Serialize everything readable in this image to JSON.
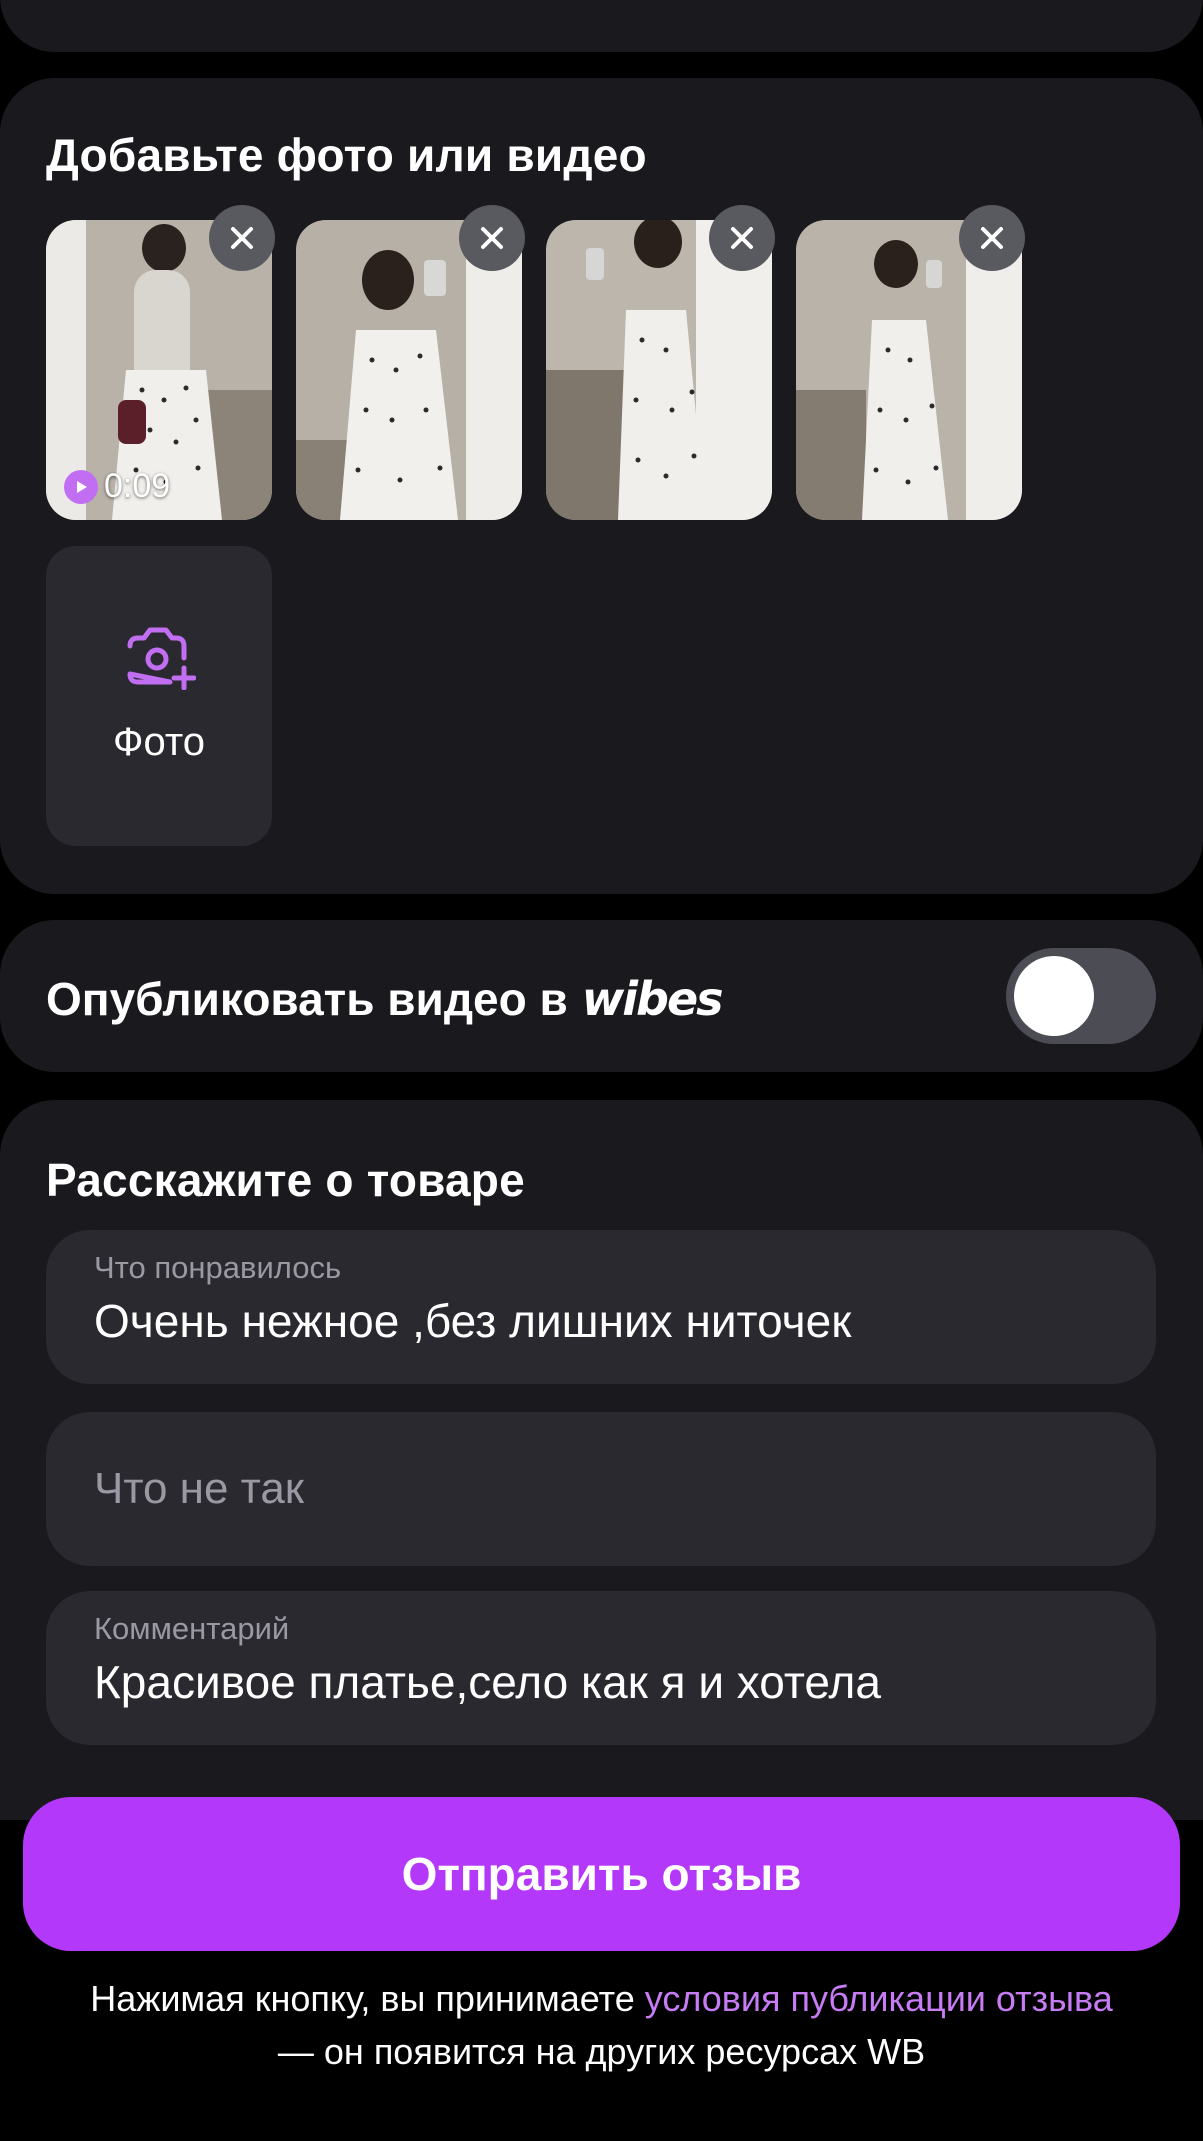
{
  "colors": {
    "background": "#000000",
    "card": "#1a191e",
    "field": "#2a2930",
    "accent": "#b338f9",
    "link": "#c77cf5",
    "muted_text": "#9a99a3",
    "toggle_off": "#4c4c54"
  },
  "media": {
    "title": "Добавьте фото или видео",
    "thumbnails": [
      {
        "type": "video",
        "duration": "0:09",
        "remove_icon": "close-icon"
      },
      {
        "type": "photo",
        "remove_icon": "close-icon"
      },
      {
        "type": "photo",
        "remove_icon": "close-icon"
      },
      {
        "type": "photo",
        "remove_icon": "close-icon"
      }
    ],
    "add_photo": {
      "icon": "camera-plus-icon",
      "label": "Фото"
    }
  },
  "vibes": {
    "label": "Опубликовать видео в",
    "logo": "wibes",
    "toggle_on": false
  },
  "review": {
    "title": "Расскажите о товаре",
    "fields": {
      "pros": {
        "label": "Что понравилось",
        "value": "Очень нежное ,без лишних ниточек"
      },
      "cons": {
        "placeholder": "Что не так"
      },
      "comment": {
        "label": "Комментарий",
        "value": "Красивое платье,село как я и хотела"
      }
    }
  },
  "submit": {
    "label": "Отправить отзыв"
  },
  "disclaimer": {
    "prefix": "Нажимая кнопку, вы принимаете ",
    "link": "условия публикации отзыва",
    "suffix": "— он появится на других ресурсах WB"
  }
}
